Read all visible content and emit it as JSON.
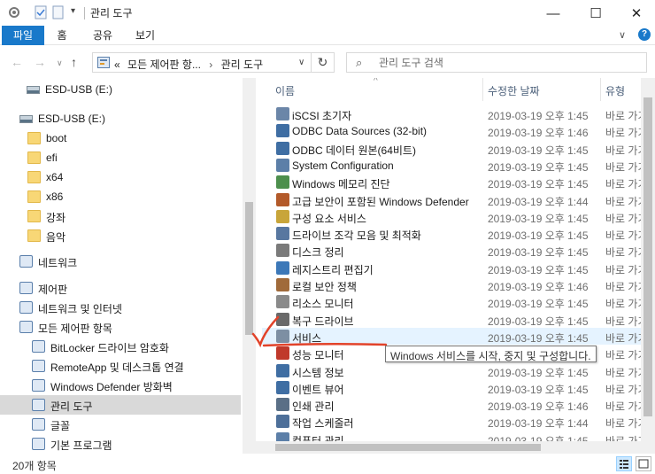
{
  "window": {
    "title": "관리 도구",
    "controls": {
      "minimize": "—",
      "maximize": "☐",
      "close": "✕"
    }
  },
  "ribbon": {
    "tabs": [
      "파일",
      "홈",
      "공유",
      "보기"
    ],
    "expand": "∨",
    "help": "?"
  },
  "address": {
    "back": "←",
    "forward": "→",
    "recent": "∨",
    "up": "↑",
    "prefix": "«",
    "path": [
      "모든 제어판 항...",
      "관리 도구"
    ],
    "separator": "›",
    "dropdown": "∨",
    "refresh": "↻"
  },
  "search": {
    "icon": "⌕",
    "placeholder": "관리 도구 검색"
  },
  "nav": [
    {
      "label": "ESD-USB (E:)",
      "icon": "drive-icon"
    },
    {
      "label": "ESD-USB (E:)",
      "icon": "drive-icon"
    },
    {
      "label": "boot",
      "icon": "folder-icon"
    },
    {
      "label": "efi",
      "icon": "folder-icon"
    },
    {
      "label": "x64",
      "icon": "folder-icon"
    },
    {
      "label": "x86",
      "icon": "folder-icon"
    },
    {
      "label": "강좌",
      "icon": "folder-icon"
    },
    {
      "label": "음악",
      "icon": "folder-icon"
    },
    {
      "label": "네트워크",
      "icon": "network-icon"
    },
    {
      "label": "제어판",
      "icon": "control-panel-icon"
    },
    {
      "label": "네트워크 및 인터넷",
      "icon": "network-internet-icon"
    },
    {
      "label": "모든 제어판 항목",
      "icon": "control-panel-icon"
    },
    {
      "label": "BitLocker 드라이브 암호화",
      "icon": "bitlocker-icon"
    },
    {
      "label": "RemoteApp 및 데스크톱 연결",
      "icon": "remoteapp-icon"
    },
    {
      "label": "Windows Defender 방화벽",
      "icon": "firewall-icon"
    },
    {
      "label": "관리 도구",
      "icon": "admin-tools-icon",
      "selected": true
    },
    {
      "label": "글꼴",
      "icon": "fonts-icon"
    },
    {
      "label": "기본 프로그램",
      "icon": "default-programs-icon"
    }
  ],
  "columns": {
    "name": "이름",
    "date": "수정한 날짜",
    "type": "유형",
    "sort": "^"
  },
  "files": [
    {
      "name": "iSCSI 초기자",
      "date": "2019-03-19 오후 1:45",
      "type": "바로 가기",
      "color": "#6b86a8"
    },
    {
      "name": "ODBC Data Sources (32-bit)",
      "date": "2019-03-19 오후 1:46",
      "type": "바로 가기",
      "color": "#3f6ea3"
    },
    {
      "name": "ODBC 데이터 원본(64비트)",
      "date": "2019-03-19 오후 1:45",
      "type": "바로 가기",
      "color": "#3f6ea3"
    },
    {
      "name": "System Configuration",
      "date": "2019-03-19 오후 1:45",
      "type": "바로 가기",
      "color": "#5c7fa8"
    },
    {
      "name": "Windows 메모리 진단",
      "date": "2019-03-19 오후 1:45",
      "type": "바로 가기",
      "color": "#4d8f4d"
    },
    {
      "name": "고급 보안이 포함된 Windows Defender ...",
      "date": "2019-03-19 오후 1:44",
      "type": "바로 가기",
      "color": "#b35a2a"
    },
    {
      "name": "구성 요소 서비스",
      "date": "2019-03-19 오후 1:45",
      "type": "바로 가기",
      "color": "#c8a53a"
    },
    {
      "name": "드라이브 조각 모음 및 최적화",
      "date": "2019-03-19 오후 1:45",
      "type": "바로 가기",
      "color": "#5877a0"
    },
    {
      "name": "디스크 정리",
      "date": "2019-03-19 오후 1:45",
      "type": "바로 가기",
      "color": "#7a7a7a"
    },
    {
      "name": "레지스트리 편집기",
      "date": "2019-03-19 오후 1:45",
      "type": "바로 가기",
      "color": "#3c78b8"
    },
    {
      "name": "로컬 보안 정책",
      "date": "2019-03-19 오후 1:46",
      "type": "바로 가기",
      "color": "#a06a3a"
    },
    {
      "name": "리소스 모니터",
      "date": "2019-03-19 오후 1:45",
      "type": "바로 가기",
      "color": "#8a8a8a"
    },
    {
      "name": "복구 드라이브",
      "date": "2019-03-19 오후 1:45",
      "type": "바로 가기",
      "color": "#6a6a6a"
    },
    {
      "name": "서비스",
      "date": "2019-03-19 오후 1:45",
      "type": "바로 가기",
      "color": "#7d8fa3",
      "hover": true
    },
    {
      "name": "성능 모니터",
      "date": "2019-03-19 오후 1:45",
      "type": "바로 가기",
      "color": "#c0392b"
    },
    {
      "name": "시스템 정보",
      "date": "2019-03-19 오후 1:45",
      "type": "바로 가기",
      "color": "#3f6ea3"
    },
    {
      "name": "이벤트 뷰어",
      "date": "2019-03-19 오후 1:45",
      "type": "바로 가기",
      "color": "#3f6ea3"
    },
    {
      "name": "인쇄 관리",
      "date": "2019-03-19 오후 1:46",
      "type": "바로 가기",
      "color": "#5a6f86"
    },
    {
      "name": "작업 스케줄러",
      "date": "2019-03-19 오후 1:44",
      "type": "바로 가기",
      "color": "#4d6f99"
    },
    {
      "name": "컴퓨터 관리",
      "date": "2019-03-19 오후 1:45",
      "type": "바로 가기",
      "color": "#5c7fa8"
    }
  ],
  "tooltip": "Windows 서비스를 시작, 중지 및 구성합니다.",
  "status": {
    "count": "20개 항목"
  }
}
